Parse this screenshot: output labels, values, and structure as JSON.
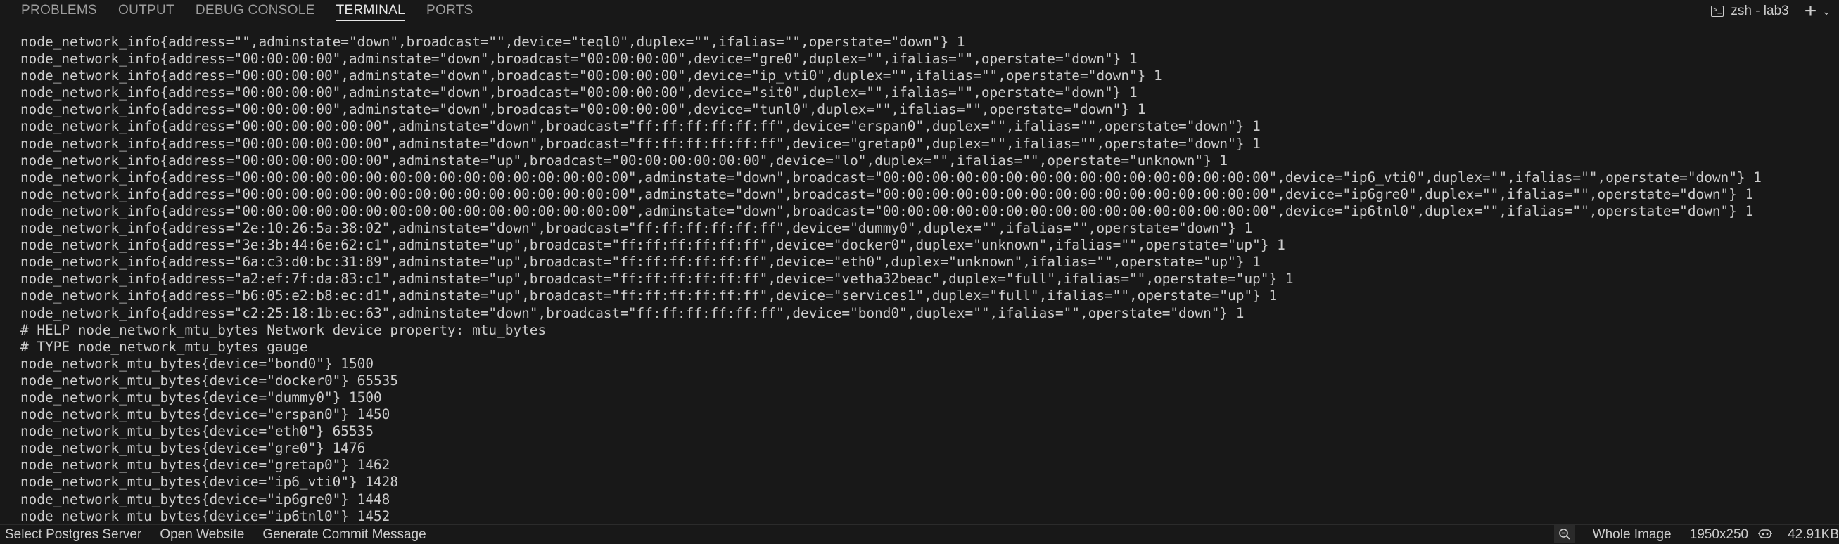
{
  "tabs": [
    {
      "label": "PROBLEMS",
      "active": false
    },
    {
      "label": "OUTPUT",
      "active": false
    },
    {
      "label": "DEBUG CONSOLE",
      "active": false
    },
    {
      "label": "TERMINAL",
      "active": true
    },
    {
      "label": "PORTS",
      "active": false
    }
  ],
  "terminal_header": {
    "title": "zsh - lab3",
    "icon": "terminal-icon",
    "new_terminal_icon": "plus-icon",
    "dropdown_icon": "chevron-down-icon"
  },
  "terminal_lines": [
    "node_network_info{address=\"\",adminstate=\"down\",broadcast=\"\",device=\"teql0\",duplex=\"\",ifalias=\"\",operstate=\"down\"} 1",
    "node_network_info{address=\"00:00:00:00\",adminstate=\"down\",broadcast=\"00:00:00:00\",device=\"gre0\",duplex=\"\",ifalias=\"\",operstate=\"down\"} 1",
    "node_network_info{address=\"00:00:00:00\",adminstate=\"down\",broadcast=\"00:00:00:00\",device=\"ip_vti0\",duplex=\"\",ifalias=\"\",operstate=\"down\"} 1",
    "node_network_info{address=\"00:00:00:00\",adminstate=\"down\",broadcast=\"00:00:00:00\",device=\"sit0\",duplex=\"\",ifalias=\"\",operstate=\"down\"} 1",
    "node_network_info{address=\"00:00:00:00\",adminstate=\"down\",broadcast=\"00:00:00:00\",device=\"tunl0\",duplex=\"\",ifalias=\"\",operstate=\"down\"} 1",
    "node_network_info{address=\"00:00:00:00:00:00\",adminstate=\"down\",broadcast=\"ff:ff:ff:ff:ff:ff\",device=\"erspan0\",duplex=\"\",ifalias=\"\",operstate=\"down\"} 1",
    "node_network_info{address=\"00:00:00:00:00:00\",adminstate=\"down\",broadcast=\"ff:ff:ff:ff:ff:ff\",device=\"gretap0\",duplex=\"\",ifalias=\"\",operstate=\"down\"} 1",
    "node_network_info{address=\"00:00:00:00:00:00\",adminstate=\"up\",broadcast=\"00:00:00:00:00:00\",device=\"lo\",duplex=\"\",ifalias=\"\",operstate=\"unknown\"} 1",
    "node_network_info{address=\"00:00:00:00:00:00:00:00:00:00:00:00:00:00:00:00\",adminstate=\"down\",broadcast=\"00:00:00:00:00:00:00:00:00:00:00:00:00:00:00:00\",device=\"ip6_vti0\",duplex=\"\",ifalias=\"\",operstate=\"down\"} 1",
    "node_network_info{address=\"00:00:00:00:00:00:00:00:00:00:00:00:00:00:00:00\",adminstate=\"down\",broadcast=\"00:00:00:00:00:00:00:00:00:00:00:00:00:00:00:00\",device=\"ip6gre0\",duplex=\"\",ifalias=\"\",operstate=\"down\"} 1",
    "node_network_info{address=\"00:00:00:00:00:00:00:00:00:00:00:00:00:00:00:00\",adminstate=\"down\",broadcast=\"00:00:00:00:00:00:00:00:00:00:00:00:00:00:00:00\",device=\"ip6tnl0\",duplex=\"\",ifalias=\"\",operstate=\"down\"} 1",
    "node_network_info{address=\"2e:10:26:5a:38:02\",adminstate=\"down\",broadcast=\"ff:ff:ff:ff:ff:ff\",device=\"dummy0\",duplex=\"\",ifalias=\"\",operstate=\"down\"} 1",
    "node_network_info{address=\"3e:3b:44:6e:62:c1\",adminstate=\"up\",broadcast=\"ff:ff:ff:ff:ff:ff\",device=\"docker0\",duplex=\"unknown\",ifalias=\"\",operstate=\"up\"} 1",
    "node_network_info{address=\"6a:c3:d0:bc:31:89\",adminstate=\"up\",broadcast=\"ff:ff:ff:ff:ff:ff\",device=\"eth0\",duplex=\"unknown\",ifalias=\"\",operstate=\"up\"} 1",
    "node_network_info{address=\"a2:ef:7f:da:83:c1\",adminstate=\"up\",broadcast=\"ff:ff:ff:ff:ff:ff\",device=\"vetha32beac\",duplex=\"full\",ifalias=\"\",operstate=\"up\"} 1",
    "node_network_info{address=\"b6:05:e2:b8:ec:d1\",adminstate=\"up\",broadcast=\"ff:ff:ff:ff:ff:ff\",device=\"services1\",duplex=\"full\",ifalias=\"\",operstate=\"up\"} 1",
    "node_network_info{address=\"c2:25:18:1b:ec:63\",adminstate=\"down\",broadcast=\"ff:ff:ff:ff:ff:ff\",device=\"bond0\",duplex=\"\",ifalias=\"\",operstate=\"down\"} 1",
    "# HELP node_network_mtu_bytes Network device property: mtu_bytes",
    "# TYPE node_network_mtu_bytes gauge",
    "node_network_mtu_bytes{device=\"bond0\"} 1500",
    "node_network_mtu_bytes{device=\"docker0\"} 65535",
    "node_network_mtu_bytes{device=\"dummy0\"} 1500",
    "node_network_mtu_bytes{device=\"erspan0\"} 1450",
    "node_network_mtu_bytes{device=\"eth0\"} 65535",
    "node_network_mtu_bytes{device=\"gre0\"} 1476",
    "node_network_mtu_bytes{device=\"gretap0\"} 1462",
    "node_network_mtu_bytes{device=\"ip6_vti0\"} 1428",
    "node_network_mtu_bytes{device=\"ip6gre0\"} 1448",
    "node_network_mtu_bytes{device=\"ip6tnl0\"} 1452"
  ],
  "statusbar": {
    "left_items": [
      "Select Postgres Server",
      "Open Website",
      "Generate Commit Message"
    ],
    "zoom_icon": "zoom-out-icon",
    "image_scope": "Whole Image",
    "image_dimensions": "1950x250",
    "people_icon": "copilot-icon",
    "file_size": "42.91KB"
  },
  "colors": {
    "background": "#181818",
    "text": "#cccccc",
    "tab_inactive": "#9d9d9d",
    "tab_active": "#e7e7e7"
  }
}
